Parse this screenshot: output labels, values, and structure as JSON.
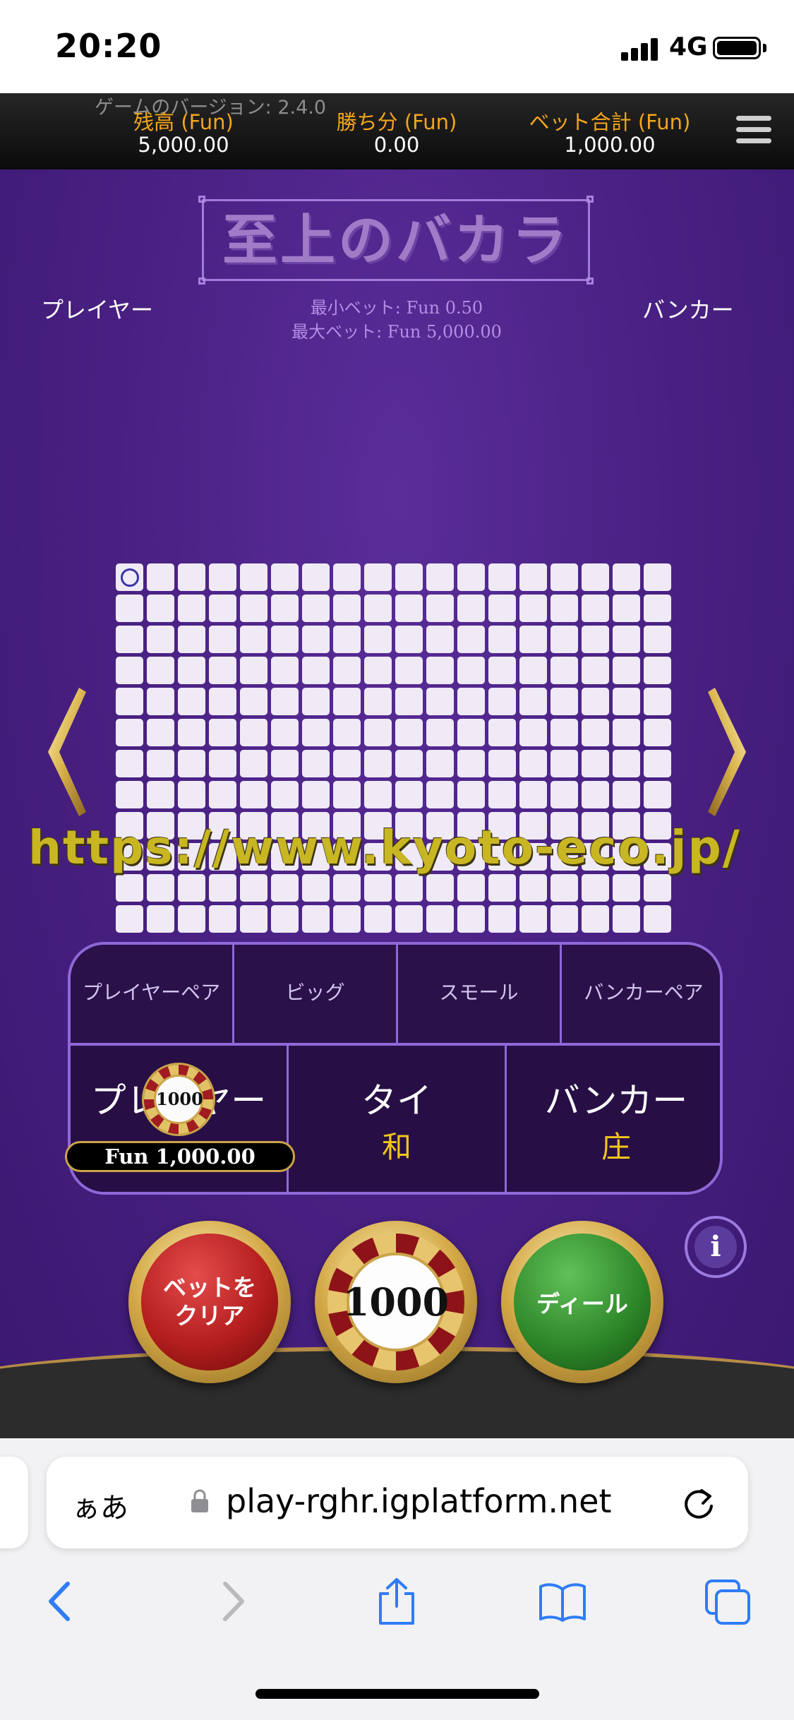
{
  "status_bar": {
    "time": "20:20",
    "network": "4G"
  },
  "game": {
    "version": "ゲームのバージョン: 2.4.0",
    "stats": [
      {
        "label": "残高 (Fun)",
        "value": "5,000.00"
      },
      {
        "label": "勝ち分 (Fun)",
        "value": "0.00"
      },
      {
        "label": "ベット合計 (Fun)",
        "value": "1,000.00"
      }
    ],
    "title": "至上のバカラ",
    "min_bet": "最小ベット: Fun 0.50",
    "max_bet": "最大ベット: Fun 5,000.00",
    "player_label": "プレイヤー",
    "banker_label": "バンカー",
    "watermark": "https://www.kyoto-eco.jp/",
    "side_bets": [
      "プレイヤーペア",
      "ビッグ",
      "スモール",
      "バンカーペア"
    ],
    "main_bets": [
      {
        "label": "プレイヤー",
        "sub": ""
      },
      {
        "label": "タイ",
        "sub": "和"
      },
      {
        "label": "バンカー",
        "sub": "庄"
      }
    ],
    "placed_chip": "1000",
    "placed_amount": "Fun 1,000.00",
    "info_label": "i",
    "buttons": {
      "clear": "ベットを\nクリア",
      "chip": "1000",
      "deal": "ディール"
    }
  },
  "browser": {
    "aa_label": "ぁあ",
    "url": "play-rghr.igplatform.net"
  },
  "colors": {
    "accent_gold": "#f4a51c",
    "table_purple": "#4a2184",
    "board_border": "#8f68d8",
    "tie_banker_char": "#f3c51b"
  }
}
